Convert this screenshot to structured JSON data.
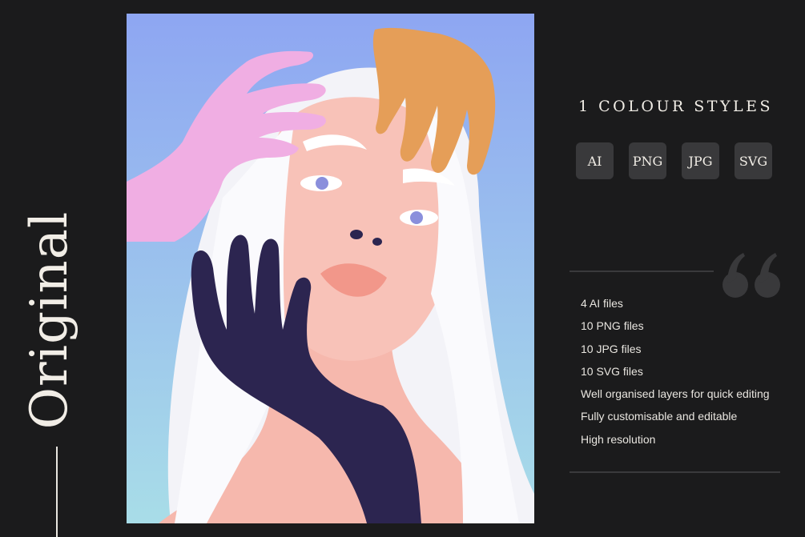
{
  "sidebar": {
    "vertical_title": "Original"
  },
  "product": {
    "styles_heading": "1 COLOUR STYLES"
  },
  "formats": [
    "AI",
    "PNG",
    "JPG",
    "SVG"
  ],
  "features": [
    "4 AI files",
    "10 PNG files",
    "10 JPG files",
    "10 SVG files",
    "Well organised layers for quick editing",
    "Fully customisable and editable",
    "High resolution"
  ],
  "icons": {
    "quote": "quote-mark-icon"
  },
  "colors": {
    "background": "#1b1b1c",
    "badge": "#39393b",
    "text": "#f1ede6",
    "sky_top": "#8ea6f2",
    "sky_bottom": "#a8dde8",
    "skin": "#f6b8ad",
    "pink_hand": "#f0aee3",
    "orange_hand": "#e59e58",
    "navy_hand": "#2c2550"
  }
}
